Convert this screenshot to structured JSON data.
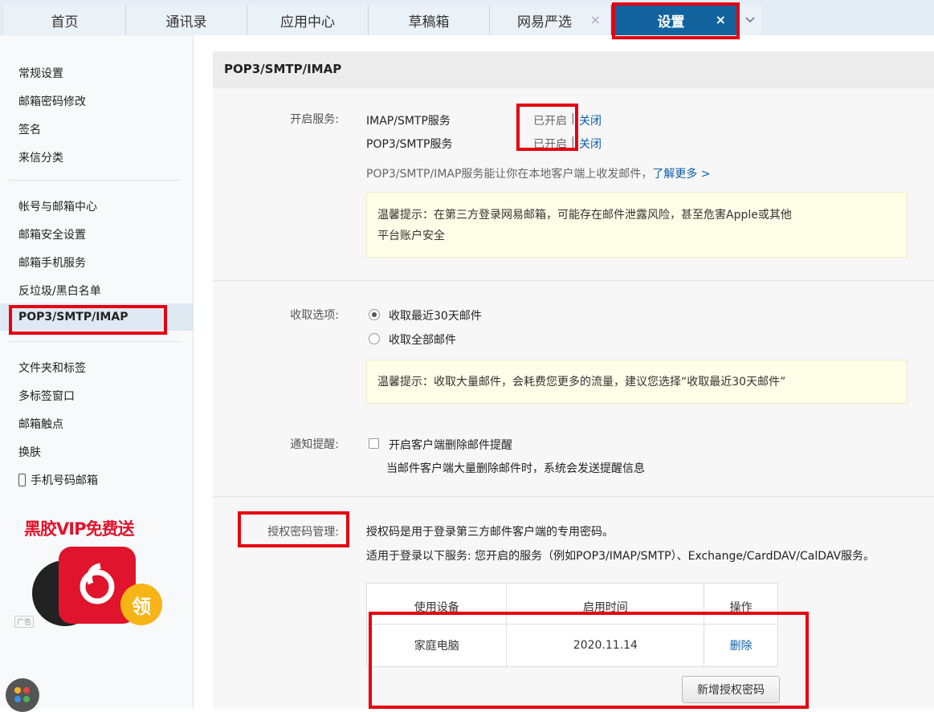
{
  "tabs": [
    {
      "label": "首页"
    },
    {
      "label": "通讯录"
    },
    {
      "label": "应用中心"
    },
    {
      "label": "草稿箱"
    },
    {
      "label": "网易严选",
      "close": "×"
    },
    {
      "label": "设置",
      "close": "×"
    }
  ],
  "tab_more_icon": "chevron-down-icon",
  "sidebar": {
    "group1": [
      "常规设置",
      "邮箱密码修改",
      "签名",
      "来信分类"
    ],
    "group2": [
      "帐号与邮箱中心",
      "邮箱安全设置",
      "邮箱手机服务",
      "反垃圾/黑白名单",
      "POP3/SMTP/IMAP"
    ],
    "group3": [
      "文件夹和标签",
      "多标签窗口",
      "邮箱触点",
      "换肤",
      "手机号码邮箱"
    ]
  },
  "ad": {
    "title": "黑胶VIP免费送",
    "coin": "领",
    "label": "广告"
  },
  "main": {
    "title": "POP3/SMTP/IMAP",
    "services": {
      "label": "开启服务:",
      "rows": [
        {
          "name": "IMAP/SMTP服务",
          "status": "已开启",
          "sep": "|",
          "action": "关闭"
        },
        {
          "name": "POP3/SMTP服务",
          "status": "已开启",
          "sep": "|",
          "action": "关闭"
        }
      ],
      "desc": "POP3/SMTP/IMAP服务能让你在本地客户端上收发邮件，",
      "learn_more": "了解更多 >",
      "tip_line1": "温馨提示：在第三方登录网易邮箱，可能存在邮件泄露风险，甚至危害Apple或其他",
      "tip_line2": "平台账户安全"
    },
    "receive": {
      "label": "收取选项:",
      "opt1": "收取最近30天邮件",
      "opt2": "收取全部邮件",
      "tip": "温馨提示：收取大量邮件，会耗费您更多的流量，建议您选择“收取最近30天邮件”"
    },
    "notify": {
      "label": "通知提醒:",
      "checkbox_label": "开启客户端删除邮件提醒",
      "desc": "当邮件客户端大量删除邮件时，系统会发送提醒信息"
    },
    "auth": {
      "label": "授权密码管理:",
      "desc1": "授权码是用于登录第三方邮件客户端的专用密码。",
      "desc2": "适用于登录以下服务: 您开启的服务（例如POP3/IMAP/SMTP）、Exchange/CardDAV/CalDAV服务。",
      "headers": [
        "使用设备",
        "启用时间",
        "操作"
      ],
      "rows": [
        {
          "device": "家庭电脑",
          "time": "2020.11.14",
          "action": "删除"
        }
      ],
      "new_button": "新增授权密码"
    }
  }
}
